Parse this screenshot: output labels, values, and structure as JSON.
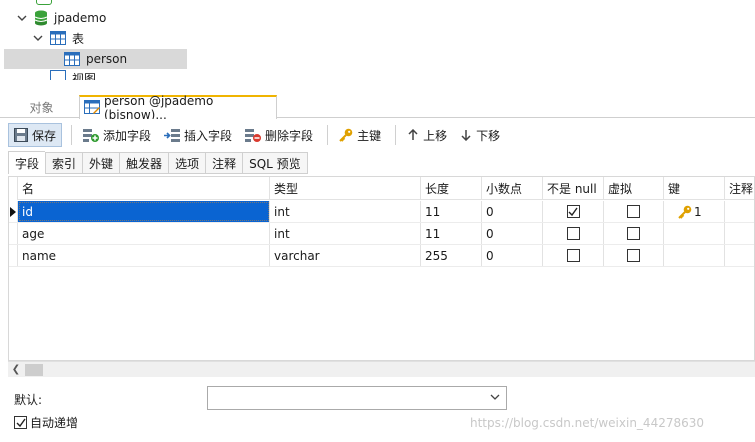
{
  "tree": {
    "db_label": "jpademo",
    "tables_label": "表",
    "table_item": "person",
    "partial_views_label": "视图"
  },
  "tabs": {
    "objects_label": "对象",
    "active_label": "person @jpademo (bisnow)..."
  },
  "toolbar": {
    "save": "保存",
    "add_field": "添加字段",
    "insert_field": "插入字段",
    "delete_field": "删除字段",
    "primary_key": "主键",
    "move_up": "上移",
    "move_down": "下移"
  },
  "subtabs": [
    "字段",
    "索引",
    "外键",
    "触发器",
    "选项",
    "注释",
    "SQL 预览"
  ],
  "grid": {
    "columns": [
      "名",
      "类型",
      "长度",
      "小数点",
      "不是 null",
      "虚拟",
      "键",
      "注释"
    ],
    "rows": [
      {
        "name": "id",
        "type": "int",
        "length": "11",
        "decimals": "0",
        "not_null": true,
        "virtual": false,
        "key": "1"
      },
      {
        "name": "age",
        "type": "int",
        "length": "11",
        "decimals": "0",
        "not_null": false,
        "virtual": false,
        "key": ""
      },
      {
        "name": "name",
        "type": "varchar",
        "length": "255",
        "decimals": "0",
        "not_null": false,
        "virtual": false,
        "key": ""
      }
    ]
  },
  "bottom": {
    "default_label": "默认:",
    "default_value": "",
    "auto_increment_label": "自动递增",
    "auto_increment_checked": true,
    "watermark": "https://blog.csdn.net/weixin_44278630"
  },
  "colors": {
    "selection": "#0a64d2",
    "tab_accent": "#f0b400",
    "key_gold": "#e0a100",
    "db_green": "#3aa23a"
  }
}
